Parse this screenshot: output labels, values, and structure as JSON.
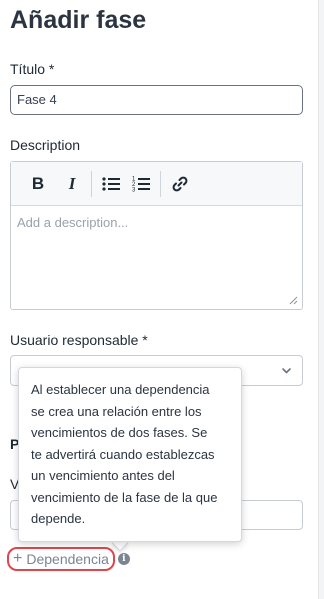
{
  "dialog": {
    "title": "Añadir fase"
  },
  "form": {
    "title_label": "Título *",
    "title_value": "Fase 4",
    "description_label": "Description",
    "description_placeholder": "Add a description...",
    "toolbar": {
      "bold": "B",
      "italic": "I"
    },
    "owner_label": "Usuario responsable *",
    "hidden_label_1": "P",
    "hidden_label_2": "V"
  },
  "dependency": {
    "button_label": "Dependencia",
    "button_icon": "plus-icon",
    "tooltip_lines": [
      "Al establecer una dependencia",
      "se crea una relación entre los",
      "vencimientos de dos fases. Se",
      "te advertirá cuando establezcas",
      "un vencimiento antes del",
      "vencimiento de la fase de la que",
      "depende."
    ]
  },
  "colors": {
    "highlight": "#e0454b",
    "muted_text": "#7a8594"
  }
}
